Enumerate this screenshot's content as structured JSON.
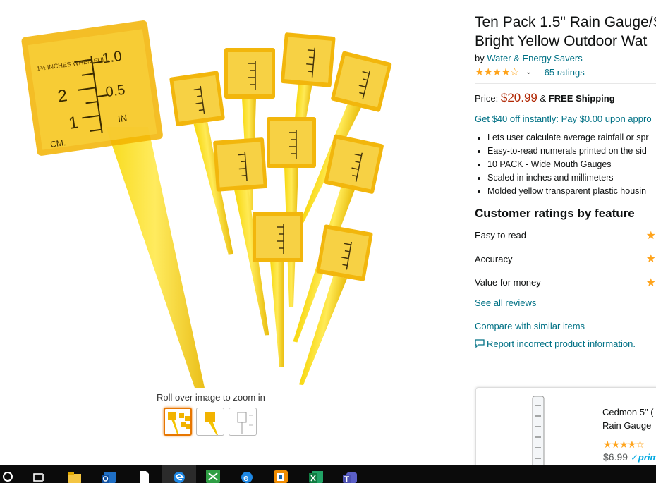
{
  "product": {
    "title_line1": "Ten Pack 1.5\" Rain Gauge/S",
    "title_line2": "Bright Yellow Outdoor Wat",
    "by_prefix": "by",
    "brand": "Water & Energy Savers",
    "stars": "★★★★☆",
    "ratings": "65 ratings",
    "price_label": "Price:",
    "price": "$20.99",
    "shipping_amp": "&",
    "shipping": "FREE Shipping",
    "promo": "Get $40 off instantly: Pay $0.00 upon appro",
    "bullets": [
      "Lets user calculate average rainfall or spr",
      "Easy-to-read numerals printed on the sid",
      "10 PACK - Wide Mouth Gauges",
      "Scaled in inches and millimeters",
      "Molded yellow transparent plastic housin"
    ]
  },
  "image": {
    "zoom_hint": "Roll over image to zoom in",
    "gauge_top_text": "1½ INCHES WHEN FULL",
    "gauge_in": "IN",
    "gauge_cm": "CM.",
    "gauge_2": "2",
    "gauge_1": "1",
    "gauge_10": "1.0",
    "gauge_05": "0.5"
  },
  "ratings_section": {
    "heading": "Customer ratings by feature",
    "features": [
      {
        "label": "Easy to read"
      },
      {
        "label": "Accuracy"
      },
      {
        "label": "Value for money"
      }
    ],
    "see_all": "See all reviews",
    "compare": "Compare with similar items",
    "report": "Report incorrect product information."
  },
  "related": {
    "name_line1": "Cedmon 5\" (",
    "name_line2": "Rain Gauge",
    "stars": "★★★★☆",
    "price": "$6.99",
    "prime": "✓prim"
  },
  "colors": {
    "gauge_yellow": "#f5c400",
    "gauge_orange": "#e8a000",
    "link": "#007185",
    "price": "#b12704"
  }
}
